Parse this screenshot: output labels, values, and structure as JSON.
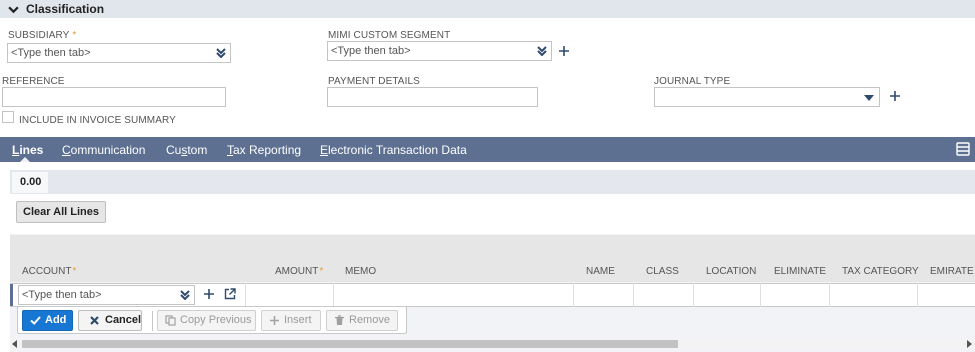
{
  "section": {
    "title": "Classification"
  },
  "fields": {
    "subsidiary": {
      "label": "SUBSIDIARY",
      "placeholder": "<Type then tab>"
    },
    "mimi_custom_segment": {
      "label": "MIMI CUSTOM SEGMENT",
      "placeholder": "<Type then tab>"
    },
    "reference": {
      "label": "REFERENCE",
      "value": ""
    },
    "payment_details": {
      "label": "PAYMENT DETAILS",
      "value": ""
    },
    "journal_type": {
      "label": "JOURNAL TYPE",
      "value": ""
    },
    "include_in_invoice_summary": {
      "label": "INCLUDE IN INVOICE SUMMARY",
      "checked": false
    }
  },
  "tabs": [
    {
      "first": "L",
      "rest": "ines",
      "active": true
    },
    {
      "first": "C",
      "rest": "ommunication",
      "active": false
    },
    {
      "pre": "Cu",
      "first": "s",
      "rest": "tom",
      "active": false
    },
    {
      "first": "T",
      "rest": "ax Reporting",
      "active": false
    },
    {
      "first": "E",
      "rest": "lectronic Transaction Data",
      "active": false
    }
  ],
  "lines": {
    "total": "0.00",
    "clear_all_label": "Clear All Lines",
    "columns": [
      "ACCOUNT",
      "AMOUNT",
      "MEMO",
      "NAME",
      "CLASS",
      "LOCATION",
      "ELIMINATE",
      "TAX CATEGORY",
      "EMIRATE"
    ],
    "account_placeholder": "<Type then tab>",
    "buttons": {
      "add": "Add",
      "cancel": "Cancel",
      "copy_previous": "Copy Previous",
      "insert": "Insert",
      "remove": "Remove"
    }
  },
  "colors": {
    "tabbar": "#5d7092",
    "primary": "#1777d3",
    "required": "#e8a02b",
    "section_header": "#e1e5ec"
  },
  "icons": [
    "chevron-down-icon",
    "double-chevron-down-icon",
    "plus-icon",
    "dropdown-arrow-icon",
    "open-external-icon",
    "checkmark-icon",
    "x-icon",
    "copy-icon",
    "trash-icon",
    "menu-icon"
  ]
}
